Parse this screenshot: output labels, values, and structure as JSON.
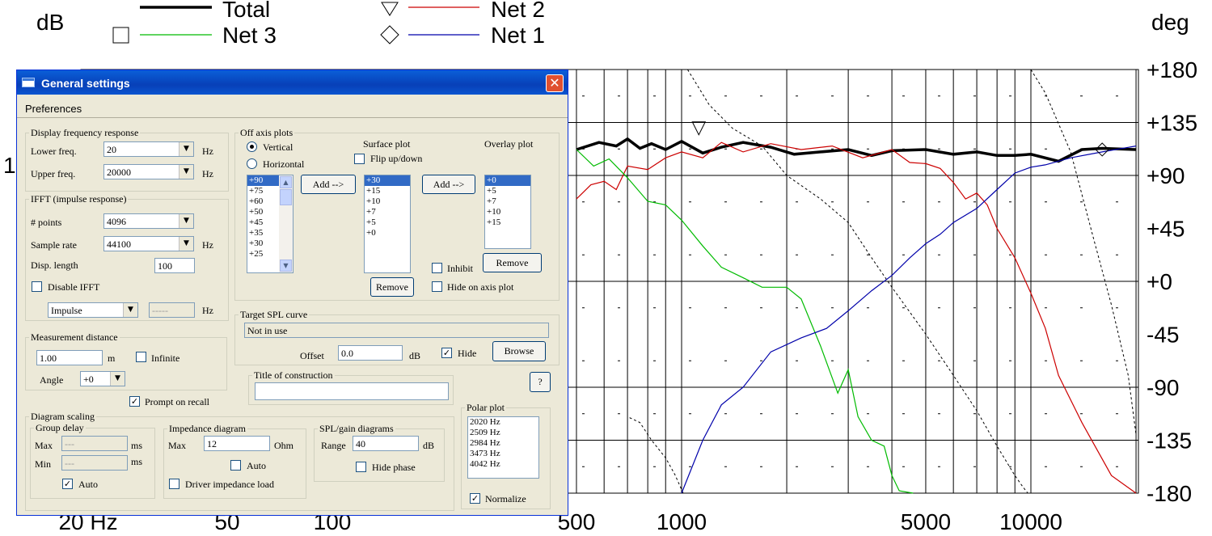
{
  "chart_data": {
    "type": "line",
    "left_axis_label": "dB",
    "right_axis_label": "deg",
    "right_ticks": [
      "+180",
      "+135",
      "+90",
      "+45",
      "+0",
      "-45",
      "-90",
      "-135",
      "-180"
    ],
    "x_ticks": [
      "20 Hz",
      "50",
      "100",
      "500",
      "1000",
      "5000",
      "10000"
    ],
    "left_tick_partial": "1",
    "legend": {
      "total": "Total",
      "net2": "Net 2",
      "net3": "Net 3",
      "net1": "Net 1"
    },
    "series": [
      {
        "name": "Total",
        "color": "#000000",
        "x": [
          500,
          580,
          650,
          700,
          760,
          820,
          900,
          1000,
          1150,
          1300,
          1500,
          1800,
          2100,
          2500,
          3000,
          3500,
          4000,
          5000,
          6000,
          7000,
          8000,
          9000,
          10000,
          12000,
          14000,
          16000,
          20000
        ],
        "y": [
          112,
          118,
          115,
          121,
          113,
          117,
          112,
          119,
          109,
          114,
          118,
          114,
          108,
          110,
          112,
          107,
          111,
          112,
          108,
          110,
          107,
          107,
          108,
          102,
          112,
          113,
          112
        ]
      },
      {
        "name": "Net 2",
        "color": "#cc0000",
        "x": [
          500,
          550,
          600,
          650,
          700,
          800,
          900,
          1000,
          1150,
          1300,
          1500,
          1800,
          2200,
          2700,
          3300,
          4000,
          4500,
          5000,
          5500,
          6000,
          6500,
          7000,
          7500,
          8000,
          9000,
          10000,
          11000,
          12000,
          14000,
          17000,
          20000
        ],
        "y": [
          70,
          82,
          85,
          78,
          98,
          95,
          105,
          110,
          105,
          118,
          110,
          117,
          112,
          115,
          105,
          112,
          101,
          100,
          96,
          84,
          70,
          75,
          65,
          45,
          20,
          -10,
          -40,
          -80,
          -120,
          -165,
          -180
        ]
      },
      {
        "name": "Net 3",
        "color": "#00bb00",
        "x": [
          500,
          560,
          620,
          700,
          800,
          900,
          1000,
          1150,
          1300,
          1500,
          1700,
          2000,
          2200,
          2500,
          2800,
          3000,
          3200,
          3500,
          3800,
          4000,
          4200,
          4600
        ],
        "y": [
          112,
          98,
          104,
          88,
          68,
          65,
          52,
          30,
          12,
          3,
          -5,
          -5,
          -15,
          -55,
          -95,
          -75,
          -115,
          -135,
          -140,
          -165,
          -178,
          -180
        ]
      },
      {
        "name": "Net 1",
        "color": "#0000aa",
        "x": [
          1000,
          1150,
          1300,
          1500,
          1800,
          2200,
          2600,
          3000,
          3500,
          4000,
          4500,
          5000,
          5500,
          6000,
          7000,
          8000,
          9000,
          10000,
          11000,
          13000,
          16000,
          20000
        ],
        "y": [
          -180,
          -135,
          -105,
          -90,
          -60,
          -48,
          -40,
          -25,
          -8,
          5,
          20,
          32,
          40,
          50,
          62,
          78,
          92,
          97,
          99,
          105,
          110,
          115
        ]
      }
    ]
  },
  "dialog": {
    "title": "General settings",
    "close_glyph": "✕",
    "menu": "Preferences",
    "display": {
      "legend": "Display frequency response",
      "lower_label": "Lower freq.",
      "lower_value": "20",
      "upper_label": "Upper freq.",
      "upper_value": "20000",
      "unit": "Hz"
    },
    "ifft": {
      "legend": "IFFT (impulse response)",
      "points_label": "# points",
      "points_value": "4096",
      "rate_label": "Sample rate",
      "rate_value": "44100",
      "rate_unit": "Hz",
      "disp_label": "Disp. length",
      "disp_value": "100",
      "disable_label": "Disable IFFT",
      "type_value": "Impulse",
      "type_extra": "-----",
      "type_unit": "Hz"
    },
    "distance": {
      "legend": "Measurement distance",
      "value": "1.00",
      "unit": "m",
      "infinite_label": "Infinite",
      "angle_label": "Angle",
      "angle_value": "+0"
    },
    "prompt_label": "Prompt on recall",
    "off_axis": {
      "legend": "Off axis plots",
      "vertical": "Vertical",
      "horizontal": "Horizontal",
      "surface_label": "Surface plot",
      "flip_label": "Flip up/down",
      "overlay_label": "Overlay plot",
      "angles": [
        "+90",
        "+75",
        "+60",
        "+50",
        "+45",
        "+35",
        "+30",
        "+25"
      ],
      "surface_list": [
        "+30",
        "+15",
        "+10",
        "+7",
        "+5",
        "+0"
      ],
      "overlay_list": [
        "+0",
        "+5",
        "+7",
        "+10",
        "+15"
      ],
      "add_label": "Add -->",
      "remove_label": "Remove",
      "inhibit_label": "Inhibit",
      "hide_on_axis_label": "Hide on axis plot"
    },
    "target": {
      "legend": "Target SPL curve",
      "value": "Not in use",
      "offset_label": "Offset",
      "offset_value": "0.0",
      "offset_unit": "dB",
      "hide_label": "Hide",
      "browse_label": "Browse"
    },
    "construction": {
      "legend": "Title of construction",
      "value": "",
      "help_label": "?"
    },
    "scaling": {
      "legend": "Diagram scaling",
      "group_legend": "Group delay",
      "max_label": "Max",
      "max_value": "---",
      "min_label": "Min",
      "min_value": "---",
      "ms": "ms",
      "auto_label": "Auto",
      "imp_legend": "Impedance diagram",
      "imp_max_label": "Max",
      "imp_max_value": "12",
      "imp_unit": "Ohm",
      "imp_auto_label": "Auto",
      "driver_label": "Driver impedance load",
      "spl_legend": "SPL/gain diagrams",
      "range_label": "Range",
      "range_value": "40",
      "range_unit": "dB",
      "hide_phase_label": "Hide phase"
    },
    "polar": {
      "legend": "Polar plot",
      "items": [
        "2020 Hz",
        "2509 Hz",
        "2984 Hz",
        "3473 Hz",
        "4042 Hz"
      ],
      "normalize_label": "Normalize"
    }
  }
}
